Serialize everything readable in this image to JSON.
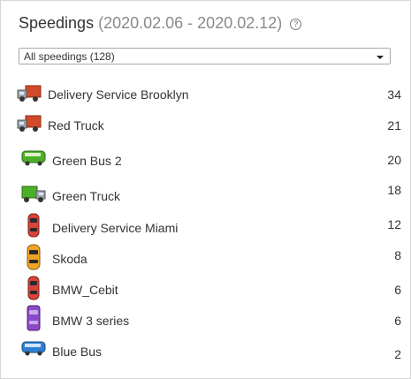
{
  "widget": {
    "title": "Speedings",
    "range": "(2020.02.06 - 2020.02.12)",
    "help_glyph": "?"
  },
  "filter": {
    "selected": "All speedings (128)"
  },
  "vehicles": [
    {
      "name": "Delivery Service Brooklyn",
      "count": "34",
      "icon": "red-truck-icon"
    },
    {
      "name": "Red Truck",
      "count": "21",
      "icon": "red-truck-icon"
    },
    {
      "name": "Green Bus 2",
      "count": "20",
      "icon": "green-bus-icon"
    },
    {
      "name": "Green Truck",
      "count": "18",
      "icon": "green-truck-icon"
    },
    {
      "name": "Delivery Service Miami",
      "count": "12",
      "icon": "red-car-icon"
    },
    {
      "name": "Skoda",
      "count": "8",
      "icon": "yellow-car-icon"
    },
    {
      "name": "BMW_Cebit",
      "count": "6",
      "icon": "red-car-icon"
    },
    {
      "name": "BMW 3 series",
      "count": "6",
      "icon": "purple-car-icon"
    },
    {
      "name": "Blue Bus",
      "count": "2",
      "icon": "blue-bus-icon"
    }
  ],
  "colors": {
    "title": "#333333",
    "range": "#8a8a8a",
    "border": "#d6d6d6"
  }
}
